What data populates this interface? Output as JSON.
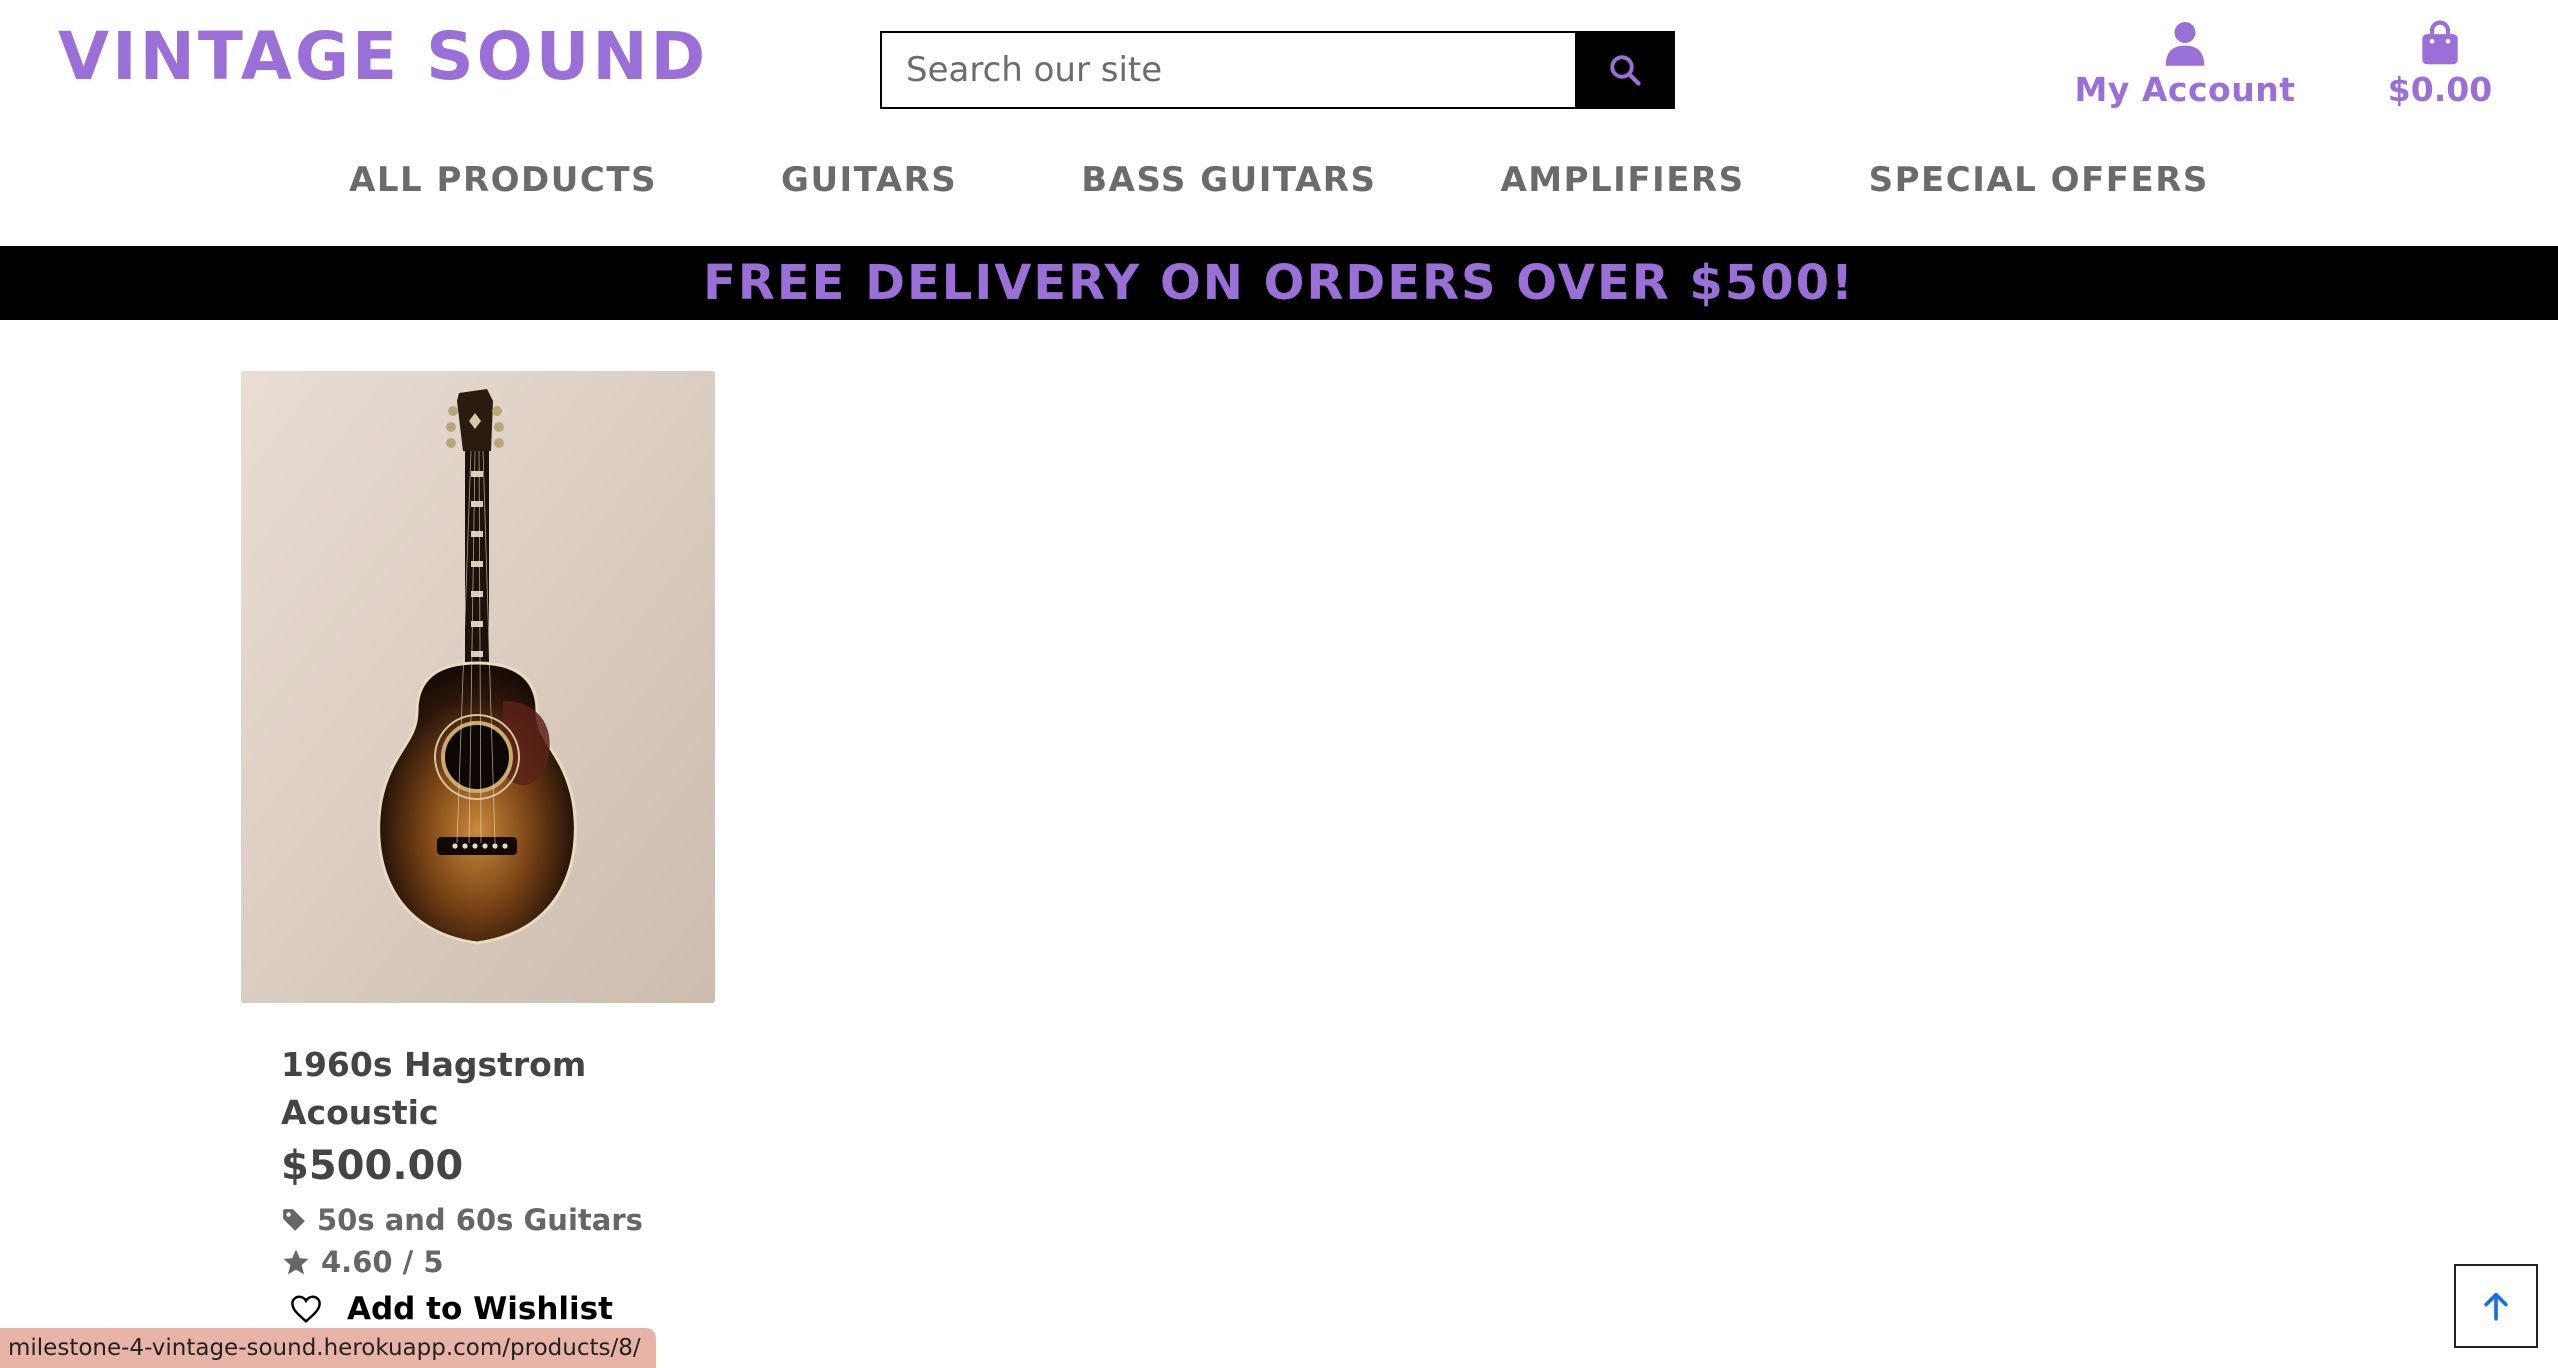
{
  "header": {
    "logo": "VINTAGE SOUND",
    "search_placeholder": "Search our site",
    "account_label": "My Account",
    "bag_total": "$0.00"
  },
  "nav": {
    "items": [
      {
        "label": "ALL PRODUCTS"
      },
      {
        "label": "GUITARS"
      },
      {
        "label": "BASS GUITARS"
      },
      {
        "label": "AMPLIFIERS"
      },
      {
        "label": "SPECIAL OFFERS"
      }
    ]
  },
  "banner": {
    "text": "FREE DELIVERY ON ORDERS OVER $500!"
  },
  "products": [
    {
      "name": "1960s Hagstrom Acoustic",
      "price": "$500.00",
      "category": "50s and 60s Guitars",
      "rating": "4.60 / 5",
      "wishlist_label": "Add to Wishlist"
    }
  ],
  "status_bar": {
    "url": "milestone-4-vintage-sound.herokuapp.com/products/8/"
  },
  "colors": {
    "brand": "#9b6fd8",
    "banner_bg": "#000000",
    "nav_text": "#6b6b6b",
    "back_to_top_arrow": "#1a6fe0"
  },
  "icons": {
    "search": "search-icon",
    "account": "user-icon",
    "bag": "shopping-bag-icon",
    "category": "tag-icon",
    "rating": "star-icon",
    "wishlist": "heart-icon",
    "back_to_top": "arrow-up-icon"
  }
}
